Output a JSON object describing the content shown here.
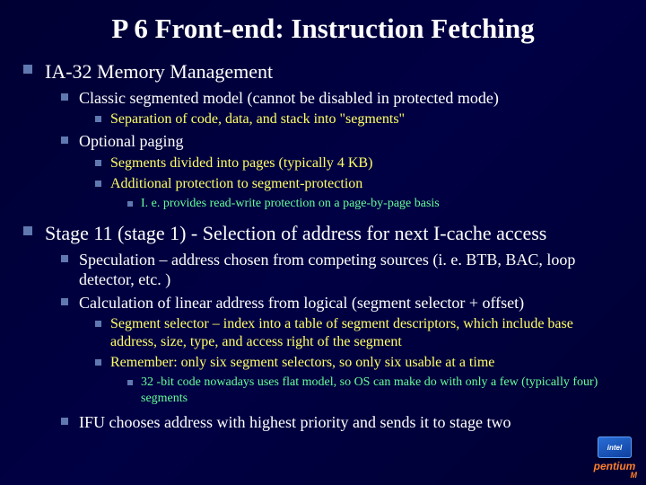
{
  "title": "P 6 Front-end: Instruction Fetching",
  "s1": {
    "heading": "IA-32 Memory Management",
    "a": {
      "text": "Classic segmented model (cannot be disabled in protected mode)",
      "i": "Separation of code, data, and stack into \"segments\""
    },
    "b": {
      "text": "Optional paging",
      "i": "Segments divided into pages (typically 4 KB)",
      "ii": "Additional protection to segment-protection",
      "ii_a": "I. e. provides read-write protection on a page-by-page basis"
    }
  },
  "s2": {
    "heading": "Stage 11 (stage 1) - Selection of address for next I-cache access",
    "a": "Speculation – address chosen from competing sources (i. e. BTB, BAC, loop detector, etc. )",
    "b": {
      "text": "Calculation of linear address from logical (segment selector + offset)",
      "i": "Segment selector – index into a table of segment descriptors, which include base address, size, type, and access right of the segment",
      "ii": "Remember: only six segment selectors, so only six usable at a time",
      "ii_a": "32 -bit code nowadays uses flat model, so OS can make do with only a few (typically four) segments"
    },
    "c": "IFU chooses address with highest priority and sends it to stage two"
  },
  "logo": {
    "chip": "intel",
    "brand": "pentium",
    "suffix": "M"
  }
}
